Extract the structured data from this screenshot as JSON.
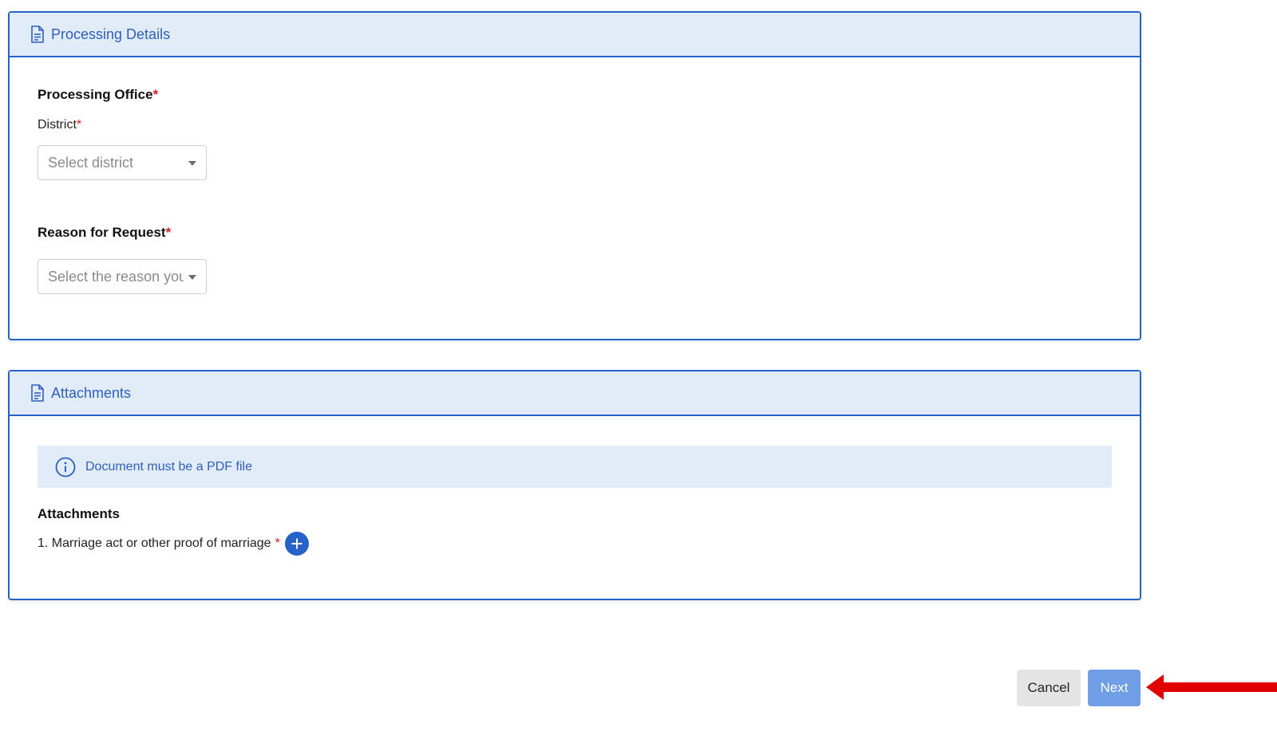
{
  "processing": {
    "header_title": "Processing Details",
    "office_label": "Processing Office",
    "district_label": "District",
    "district_placeholder": "Select district",
    "reason_label": "Reason for Request",
    "reason_placeholder": "Select the reason you",
    "required_mark": "*"
  },
  "attachments": {
    "header_title": "Attachments",
    "info_text": "Document must be a PDF file",
    "section_label": "Attachments",
    "items": [
      {
        "label": "1. Marriage act or other proof of marriage"
      }
    ],
    "required_mark": "*"
  },
  "actions": {
    "cancel_label": "Cancel",
    "next_label": "Next"
  },
  "colors": {
    "accent": "#2563c9",
    "header_bg": "#e1ecf8",
    "next_button": "#6f9de6",
    "required": "#d11f1f",
    "annotation_arrow": "#e00000"
  }
}
